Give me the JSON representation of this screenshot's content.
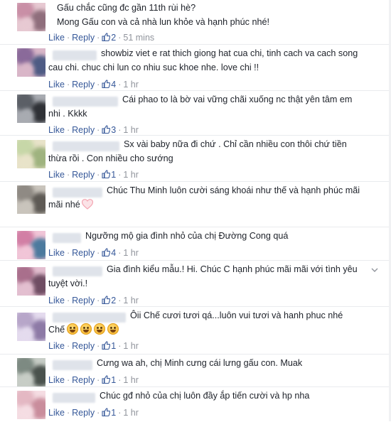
{
  "ui": {
    "like_label": "Like",
    "reply_label": "Reply",
    "separator": "·"
  },
  "comments": [
    {
      "text": "Gấu chắc cũng đc gần 11th rùi hè?\nMong Gấu con và cả nhà lun khỏe và hạnh phúc nhé!",
      "like_count": "2",
      "time": "51 mins",
      "avatar_colors": [
        "#c98fa6",
        "#e7c9d2",
        "#8f6e7c"
      ]
    },
    {
      "text": "showbiz viet e rat thich giong hat cua chi, tinh cach va cach song cau chi. chuc chi lun co nhiu suc khoe nhe. love chi !!",
      "like_count": "4",
      "time": "1 hr",
      "avatar_colors": [
        "#8a6a9a",
        "#d9b6c8",
        "#4e5b84"
      ]
    },
    {
      "text": "Cái phao to là bờ vai vững chãi xuống nc thật yên tâm em nhi . Kkkk",
      "like_count": "3",
      "time": "1 hr",
      "avatar_colors": [
        "#5b5f66",
        "#a8abb1",
        "#2f3136"
      ]
    },
    {
      "text": "Sx vài baby nữa đi chứ . Chỉ cần nhiều con thôi chứ tiền thừa rồi . Con nhiều cho sướng",
      "like_count": "1",
      "time": "1 hr",
      "avatar_colors": [
        "#c7d7a8",
        "#e8e3c9",
        "#9fb37f"
      ]
    },
    {
      "text": "Chúc Thu Minh luôn cười sáng khoái như thế và hạnh phúc mãi mãi nhé",
      "like_count": "",
      "time": "",
      "avatar_colors": [
        "#8f8a84",
        "#c9c4bc",
        "#5e5a55"
      ]
    },
    {
      "text": "Ngưỡng mộ gia đình nhỏ của chị Đường Cong quá",
      "like_count": "4",
      "time": "1 hr",
      "avatar_colors": [
        "#d27fa5",
        "#f1c5d7",
        "#4c7a9e"
      ]
    },
    {
      "text": "Gia đình kiểu mẫu.! Hi. Chúc C hạnh phúc mãi mãi với tình yêu tuyệt vời.!",
      "like_count": "2",
      "time": "1 hr",
      "avatar_colors": [
        "#a96f8c",
        "#e3bfd0",
        "#6f4d63"
      ]
    },
    {
      "text": "Ôii Chế cươi tươi qá...luôn vui tươi và hanh phuc nhé\nChế",
      "like_count": "1",
      "time": "1 hr",
      "avatar_colors": [
        "#b7a6c9",
        "#e4dbee",
        "#8d7aa6"
      ]
    },
    {
      "text": "Cưng wa ah, chị Minh cưng cái lưng gấu con. Muak",
      "like_count": "1",
      "time": "1 hr",
      "avatar_colors": [
        "#7d8a82",
        "#c7cdc6",
        "#4a524d"
      ]
    },
    {
      "text": "Chúc gđ nhỏ của chị luôn đầy ắp tiến cười và hp nha",
      "like_count": "1",
      "time": "1 hr",
      "avatar_colors": [
        "#e4b8c3",
        "#f5dde3",
        "#c98d9c"
      ]
    }
  ],
  "icons": {
    "like": "like-thumb-icon",
    "heart": "heart-icon",
    "emoji": "laughing-emoji-icon",
    "menu": "chevron-down-icon"
  },
  "colors": {
    "link": "#365899",
    "meta": "#90949c",
    "text": "#1d2129",
    "heart": "#f4a6b2"
  }
}
